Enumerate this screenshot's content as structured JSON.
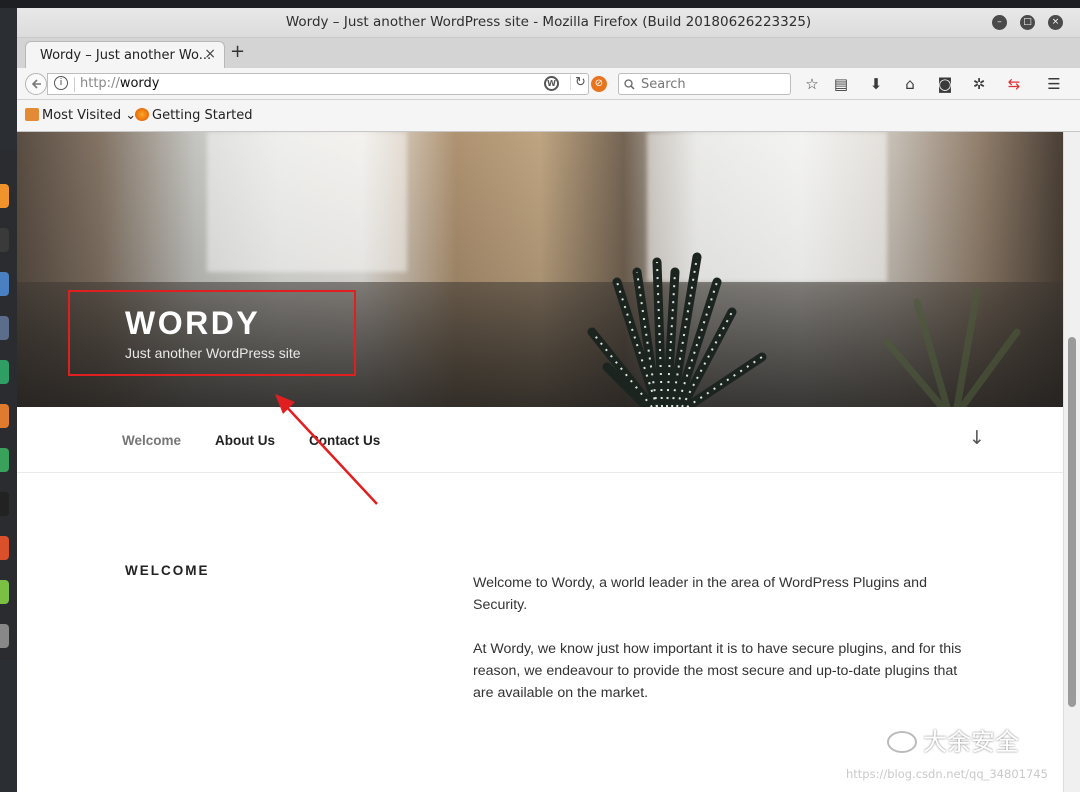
{
  "browser": {
    "window_title": "Wordy – Just another WordPress site - Mozilla Firefox (Build 20180626223325)",
    "tab_label": "Wordy – Just another Wo...",
    "tab_close": "×",
    "new_tab": "+",
    "url_protocol": "http://",
    "url_host": "wordy",
    "search_placeholder": "Search",
    "bookmarks": [
      "Most Visited",
      "Getting Started"
    ],
    "window_buttons": [
      "–",
      "□",
      "×"
    ]
  },
  "site": {
    "title": "WORDY",
    "tagline": "Just another WordPress site",
    "nav": [
      "Welcome",
      "About Us",
      "Contact Us"
    ],
    "scroll_down": "↓",
    "section_title": "WELCOME",
    "paragraphs": [
      "Welcome to Wordy, a world leader in the area of WordPress Plugins and Security.",
      "At Wordy, we know just how important it is to have secure plugins, and for this reason, we endeavour to provide the most secure and up-to-date plugins that are available on the market."
    ]
  },
  "overlay": {
    "watermark": "大余安全",
    "csdn": "https://blog.csdn.net/qq_34801745"
  },
  "colors": {
    "annotation": "#e02020",
    "accent_orange": "#e8741d"
  },
  "icons": [
    "info-icon",
    "wordpress-icon",
    "reload-icon",
    "search-icon",
    "bookmark-star-icon",
    "reader-icon",
    "download-icon",
    "home-icon",
    "pocket-icon",
    "settings-icon",
    "sync-icon",
    "menu-icon",
    "scroll-down-arrow-icon"
  ]
}
